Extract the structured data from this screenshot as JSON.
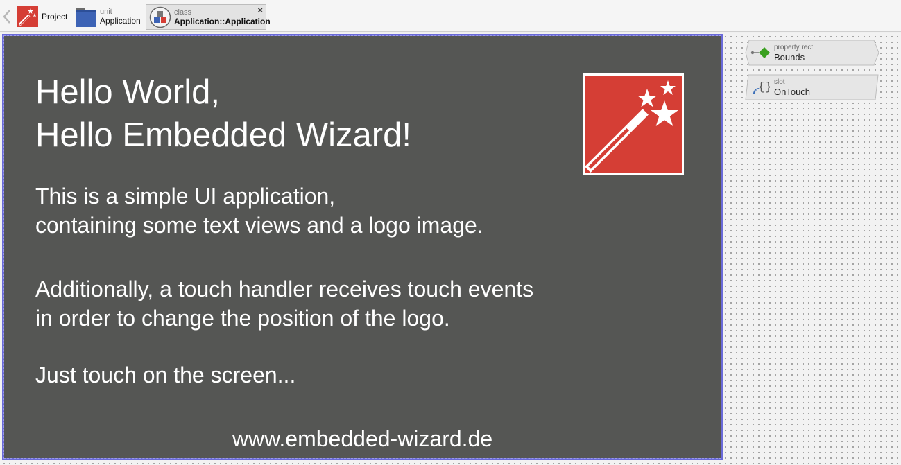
{
  "navbar": {
    "back_icon": "chevron-left-icon",
    "project": {
      "icon": "magic-wand-icon",
      "label": "Project"
    },
    "unit": {
      "icon": "folder-icon",
      "kind": "unit",
      "name": "Application"
    },
    "class": {
      "icon": "class-icon",
      "kind": "class",
      "name": "Application::Application",
      "close_label": "×"
    }
  },
  "app_screen": {
    "heading_line1": "Hello World,",
    "heading_line2": "Hello Embedded Wizard!",
    "para1_line1": "This is a simple UI application,",
    "para1_line2": "containing some text views and a logo image.",
    "para2_line1": "Additionally, a touch handler receives touch events",
    "para2_line2": "in order to change the position of the logo.",
    "para3": "Just touch on the screen...",
    "url": "www.embedded-wizard.de",
    "logo_icon": "magic-wand-logo",
    "background_color": "#555654",
    "logo_color": "#d53e35"
  },
  "members": [
    {
      "kind": "property rect",
      "name": "Bounds",
      "icon": "property-diamond-icon"
    },
    {
      "kind": "slot",
      "name": "OnTouch",
      "icon": "slot-braces-icon"
    }
  ],
  "colors": {
    "selection_border": "#6a6ad8",
    "property_green": "#3aa020",
    "slot_blue": "#3c6fb8"
  }
}
